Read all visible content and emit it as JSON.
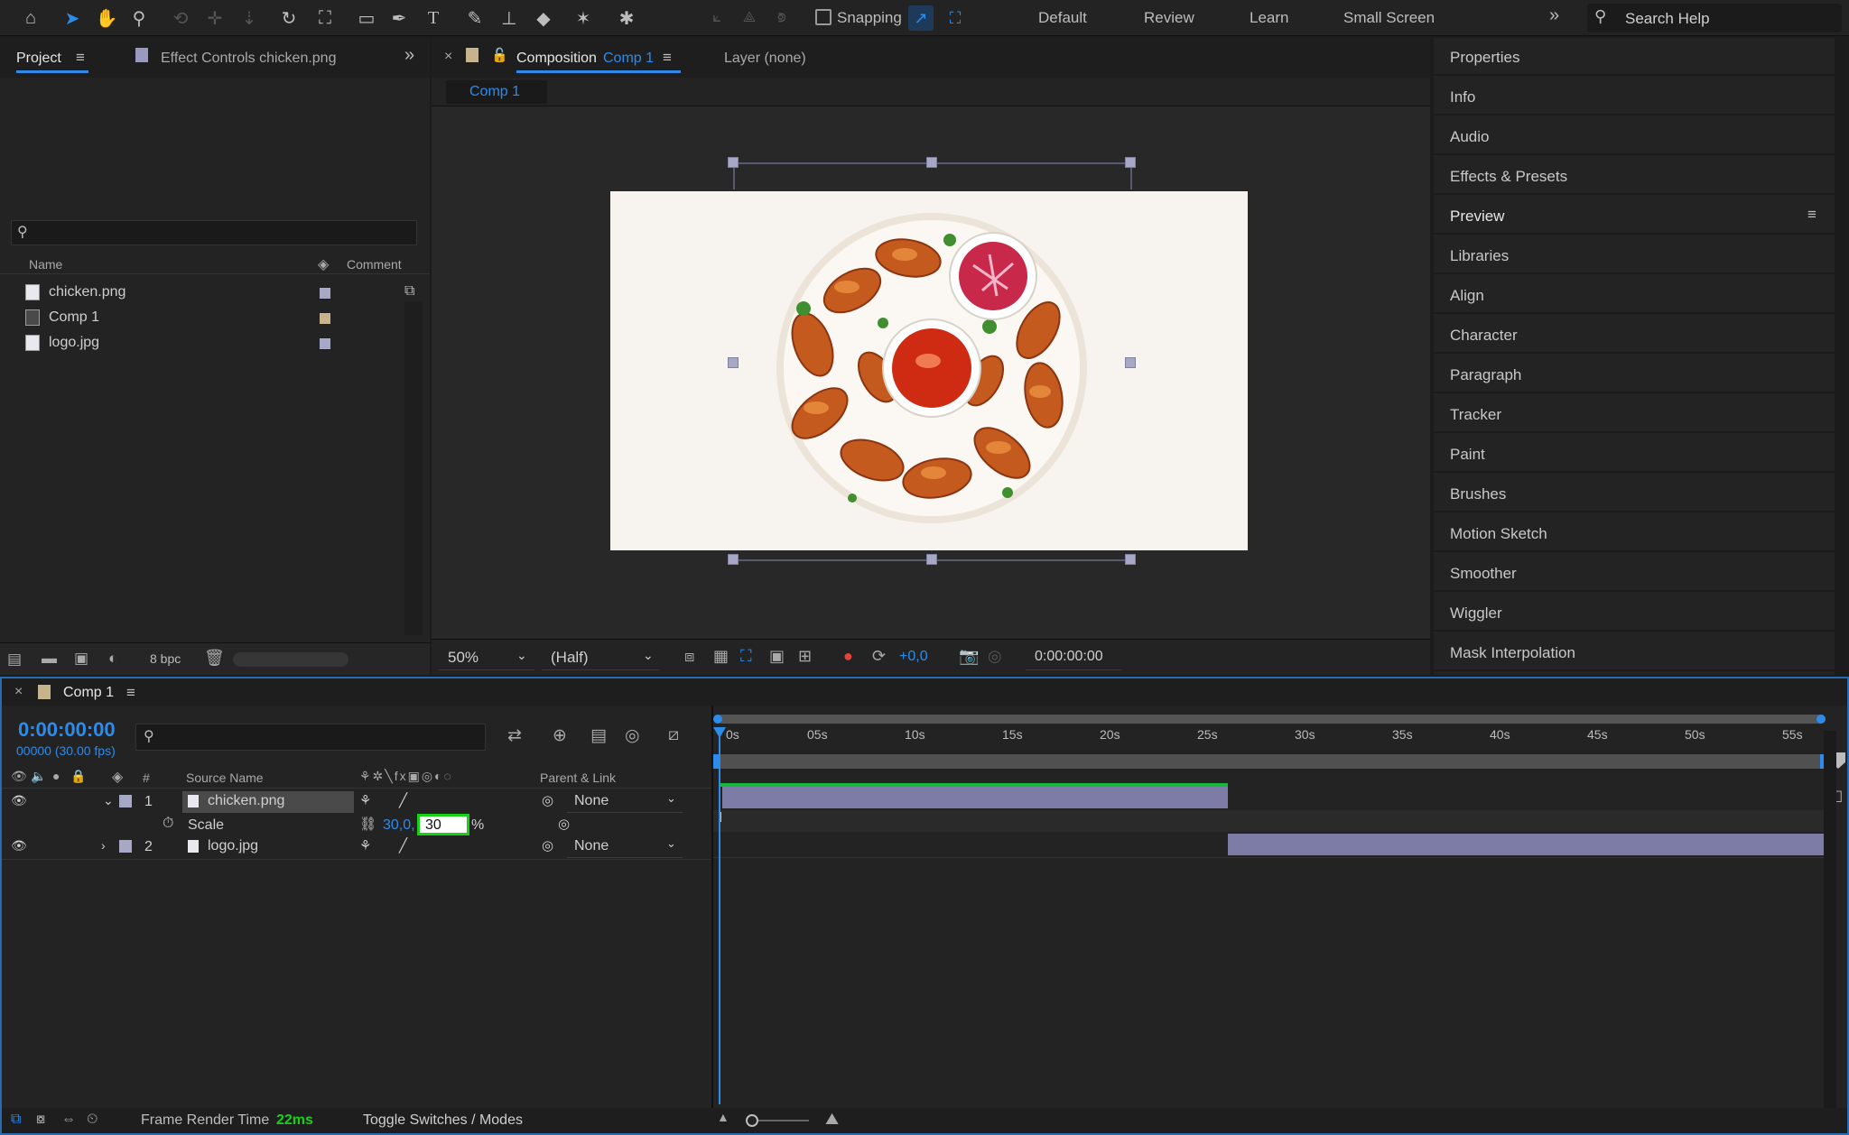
{
  "toolbar": {
    "snapping_label": "Snapping",
    "workspaces": [
      "Default",
      "Review",
      "Learn",
      "Small Screen"
    ],
    "search_placeholder": "Search Help"
  },
  "project_panel": {
    "tab_project": "Project",
    "tab_effect_controls": "Effect Controls chicken.png",
    "col_name": "Name",
    "col_comment": "Comment",
    "items": [
      {
        "name": "chicken.png",
        "label_color": "#a7a7c6"
      },
      {
        "name": "Comp 1",
        "label_color": "#c8b48c"
      },
      {
        "name": "logo.jpg",
        "label_color": "#a7a7c6"
      }
    ],
    "bpc": "8 bpc"
  },
  "composition_panel": {
    "tab_prefix": "Composition",
    "tab_comp": "Comp 1",
    "tab_layer": "Layer (none)",
    "sub_tab": "Comp 1",
    "zoom": "50%",
    "resolution": "(Half)",
    "exposure": "+0,0",
    "timecode": "0:00:00:00"
  },
  "right_panel": {
    "items": [
      "Properties",
      "Info",
      "Audio",
      "Effects & Presets",
      "Preview",
      "Libraries",
      "Align",
      "Character",
      "Paragraph",
      "Tracker",
      "Paint",
      "Brushes",
      "Motion Sketch",
      "Smoother",
      "Wiggler",
      "Mask Interpolation"
    ]
  },
  "timeline": {
    "tab_name": "Comp 1",
    "timecode": "0:00:00:00",
    "frame_info": "00000 (30.00 fps)",
    "col_source": "Source Name",
    "col_parent": "Parent & Link",
    "col_number": "#",
    "ruler_labels": [
      "0s",
      "05s",
      "10s",
      "15s",
      "20s",
      "25s",
      "30s",
      "35s",
      "40s",
      "45s",
      "50s",
      "55s"
    ],
    "layers": [
      {
        "num": "1",
        "name": "chicken.png",
        "parent": "None"
      },
      {
        "num": "2",
        "name": "logo.jpg",
        "parent": "None"
      }
    ],
    "scale_label": "Scale",
    "scale_value_1": "30,0,",
    "scale_value_2": "30",
    "scale_unit": "%",
    "status_frame_label": "Frame Render Time",
    "status_frame_value": "22ms",
    "status_toggle": "Toggle Switches / Modes"
  },
  "colors": {
    "accent": "#2d8ceb",
    "layer_track": "#7c7ca6",
    "highlight": "#16d116"
  }
}
